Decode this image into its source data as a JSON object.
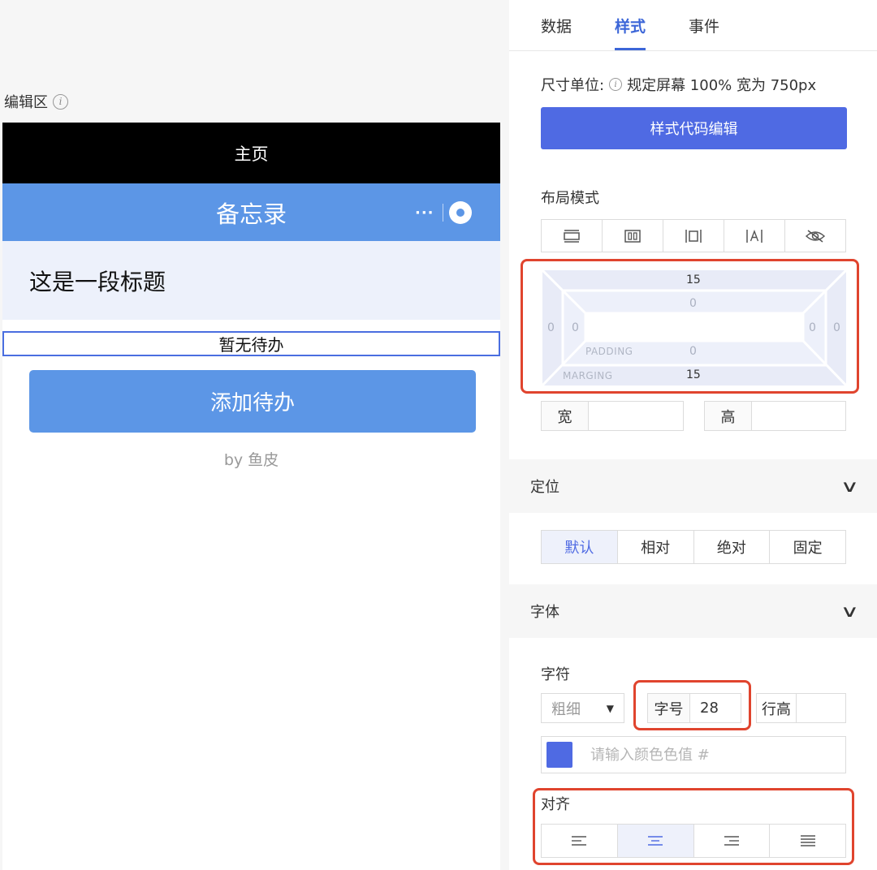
{
  "editor": {
    "label": "编辑区",
    "phone": {
      "status_bar_title": "主页",
      "nav_title": "备忘录",
      "capsule_dots": "···",
      "heading": "这是一段标题",
      "empty_text": "暂无待办",
      "add_button": "添加待办",
      "byline": "by 鱼皮"
    }
  },
  "panel": {
    "tabs": [
      {
        "label": "数据",
        "active": false
      },
      {
        "label": "样式",
        "active": true
      },
      {
        "label": "事件",
        "active": false
      }
    ],
    "unit_label": "尺寸单位:",
    "unit_desc": "规定屏幕 100% 宽为 750px",
    "style_code_button": "样式代码编辑",
    "layout_label": "布局模式",
    "layout_modes": [
      "block-icon",
      "flex-icon",
      "inline-block-icon",
      "inline-icon",
      "hidden-icon"
    ],
    "box_model": {
      "margin_top": "15",
      "margin_bottom": "15",
      "margin_left": "0",
      "margin_right": "0",
      "padding_top": "0",
      "padding_bottom": "0",
      "padding_left": "0",
      "padding_right": "0",
      "padding_label": "PADDING",
      "margin_label": "MARGING"
    },
    "width_label": "宽",
    "height_label": "高",
    "position_section": "定位",
    "position_options": [
      {
        "label": "默认",
        "active": true
      },
      {
        "label": "相对",
        "active": false
      },
      {
        "label": "绝对",
        "active": false
      },
      {
        "label": "固定",
        "active": false
      }
    ],
    "font_section": "字体",
    "char_label": "字符",
    "weight_placeholder": "粗细",
    "weight_arrow": "▼",
    "size_label": "字号",
    "size_value": "28",
    "line_height_label": "行高",
    "color_placeholder": "请输入颜色色值 #",
    "color_swatch": "#4f6ae3",
    "align_label": "对齐",
    "align_options": [
      {
        "name": "align-left-icon",
        "active": false
      },
      {
        "name": "align-center-icon",
        "active": true
      },
      {
        "name": "align-right-icon",
        "active": false
      },
      {
        "name": "align-justify-icon",
        "active": false
      }
    ],
    "chevron": "∨"
  },
  "colors": {
    "accent": "#4f6ae3",
    "nav_blue": "#5c96e6",
    "highlight_red": "#e0442e"
  }
}
